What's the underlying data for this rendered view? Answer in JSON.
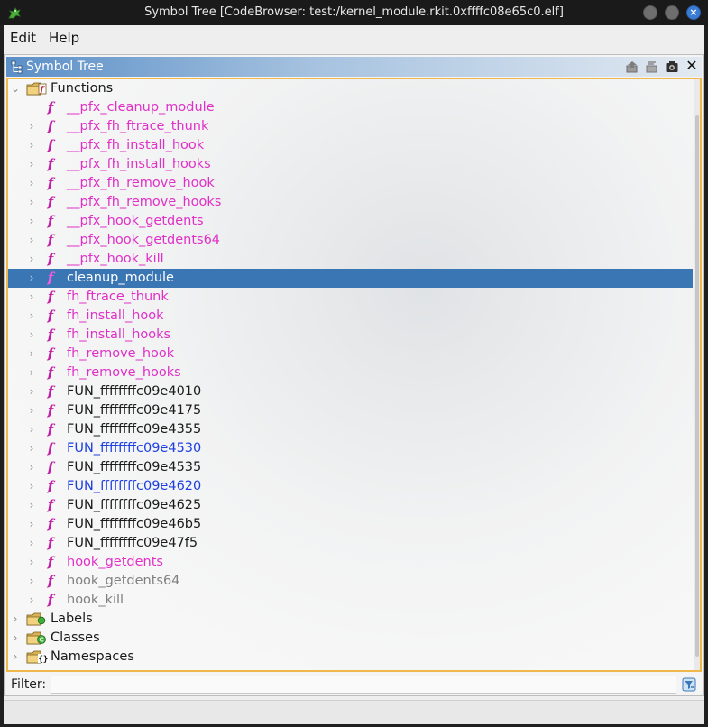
{
  "window": {
    "title": "Symbol Tree [CodeBrowser: test:/kernel_module.rkit.0xffffc08e65c0.elf]",
    "close_glyph": "×"
  },
  "menu": {
    "items": [
      "Edit",
      "Help"
    ]
  },
  "panel": {
    "title": "Symbol Tree",
    "close_glyph": "✕"
  },
  "colors": {
    "selection": "#3a76b4",
    "thunk": "#e030c8",
    "link": "#1d3fe0",
    "header_start": "#5b8fc7",
    "focus_border": "#f0b84a"
  },
  "tree": {
    "folders": {
      "functions": "Functions",
      "labels": "Labels",
      "classes": "Classes",
      "namespaces": "Namespaces"
    },
    "functions": [
      {
        "name": "__pfx_cleanup_module",
        "style": "thunk",
        "expandable": false
      },
      {
        "name": "__pfx_fh_ftrace_thunk",
        "style": "thunk",
        "expandable": true
      },
      {
        "name": "__pfx_fh_install_hook",
        "style": "thunk",
        "expandable": true
      },
      {
        "name": "__pfx_fh_install_hooks",
        "style": "thunk",
        "expandable": true
      },
      {
        "name": "__pfx_fh_remove_hook",
        "style": "thunk",
        "expandable": true
      },
      {
        "name": "__pfx_fh_remove_hooks",
        "style": "thunk",
        "expandable": true
      },
      {
        "name": "__pfx_hook_getdents",
        "style": "thunk",
        "expandable": true
      },
      {
        "name": "__pfx_hook_getdents64",
        "style": "thunk",
        "expandable": true
      },
      {
        "name": "__pfx_hook_kill",
        "style": "thunk",
        "expandable": true
      },
      {
        "name": "cleanup_module",
        "style": "selected",
        "expandable": true
      },
      {
        "name": "fh_ftrace_thunk",
        "style": "thunk",
        "expandable": true
      },
      {
        "name": "fh_install_hook",
        "style": "thunk",
        "expandable": true
      },
      {
        "name": "fh_install_hooks",
        "style": "thunk",
        "expandable": true
      },
      {
        "name": "fh_remove_hook",
        "style": "thunk",
        "expandable": true
      },
      {
        "name": "fh_remove_hooks",
        "style": "thunk",
        "expandable": true
      },
      {
        "name": "FUN_ffffffffc09e4010",
        "style": "normal",
        "expandable": true
      },
      {
        "name": "FUN_ffffffffc09e4175",
        "style": "normal",
        "expandable": true
      },
      {
        "name": "FUN_ffffffffc09e4355",
        "style": "normal",
        "expandable": true
      },
      {
        "name": "FUN_ffffffffc09e4530",
        "style": "blue",
        "expandable": true
      },
      {
        "name": "FUN_ffffffffc09e4535",
        "style": "normal",
        "expandable": true
      },
      {
        "name": "FUN_ffffffffc09e4620",
        "style": "blue",
        "expandable": true
      },
      {
        "name": "FUN_ffffffffc09e4625",
        "style": "normal",
        "expandable": true
      },
      {
        "name": "FUN_ffffffffc09e46b5",
        "style": "normal",
        "expandable": true
      },
      {
        "name": "FUN_ffffffffc09e47f5",
        "style": "normal",
        "expandable": true
      },
      {
        "name": "hook_getdents",
        "style": "thunk",
        "expandable": true
      },
      {
        "name": "hook_getdents64",
        "style": "gray",
        "expandable": true
      },
      {
        "name": "hook_kill",
        "style": "gray",
        "expandable": true
      }
    ],
    "function_icon_glyph": "f"
  },
  "filter": {
    "label": "Filter:",
    "value": "",
    "placeholder": ""
  }
}
